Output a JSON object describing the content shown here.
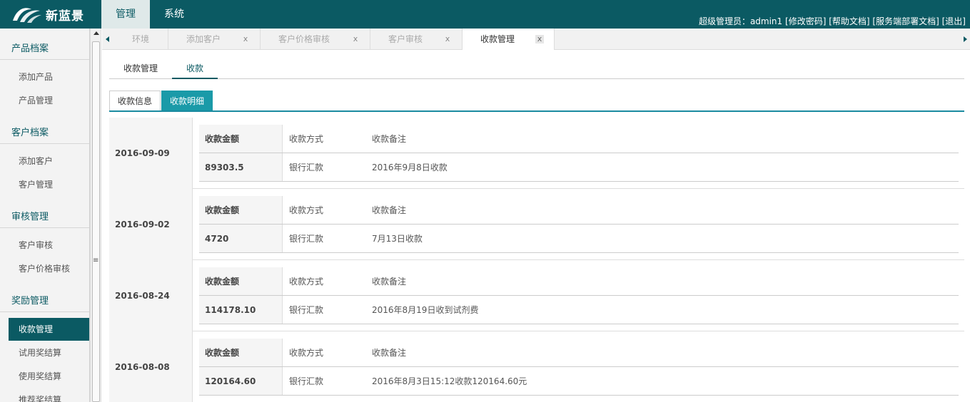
{
  "app": {
    "title": "新蓝景"
  },
  "nav": [
    {
      "label": "管理",
      "active": true
    },
    {
      "label": "系统",
      "active": false
    }
  ],
  "user_bar": {
    "role": "超级管理员：admin1",
    "links": [
      "[修改密码]",
      "[帮助文档]",
      "[服务端部署文档]",
      "[退出]"
    ]
  },
  "sidebar": {
    "groups": [
      {
        "title": "产品档案",
        "items": [
          "添加产品",
          "产品管理"
        ]
      },
      {
        "title": "客户档案",
        "items": [
          "添加客户",
          "客户管理"
        ]
      },
      {
        "title": "审核管理",
        "items": [
          "客户审核",
          "客户价格审核"
        ]
      },
      {
        "title": "奖励管理",
        "items": [
          "收款管理",
          "试用奖结算",
          "使用奖结算",
          "推荐奖结算"
        ]
      }
    ],
    "active_item": "收款管理"
  },
  "page_tabs": [
    {
      "label": "环境",
      "closable": false
    },
    {
      "label": "添加客户",
      "closable": true
    },
    {
      "label": "客户价格审核",
      "closable": true
    },
    {
      "label": "客户审核",
      "closable": true
    },
    {
      "label": "收款管理",
      "closable": true,
      "active": true
    }
  ],
  "close_glyph": "x",
  "sub_tabs": [
    {
      "label": "收款管理",
      "active": false
    },
    {
      "label": "收款",
      "active": true
    }
  ],
  "mini_tabs": [
    {
      "label": "收款信息",
      "active": false
    },
    {
      "label": "收款明细",
      "active": true
    }
  ],
  "columns": {
    "amount": "收款金额",
    "method": "收款方式",
    "note": "收款备注"
  },
  "records": [
    {
      "date": "2016-09-09",
      "amount": "89303.5",
      "method": "银行汇款",
      "note": "2016年9月8日收款"
    },
    {
      "date": "2016-09-02",
      "amount": "4720",
      "method": "银行汇款",
      "note": "7月13日收款"
    },
    {
      "date": "2016-08-24",
      "amount": "114178.10",
      "method": "银行汇款",
      "note": "2016年8月19日收到试剂费"
    },
    {
      "date": "2016-08-08",
      "amount": "120164.60",
      "method": "银行汇款",
      "note": "2016年8月3日15:12收款120164.60元"
    }
  ],
  "colors": {
    "primary": "#0b5a63",
    "accent": "#1a9aa8"
  },
  "icons": {
    "logo": "swirl-logo-icon",
    "left_arrow": "arrow-left-icon",
    "right_arrow": "arrow-right-icon"
  }
}
